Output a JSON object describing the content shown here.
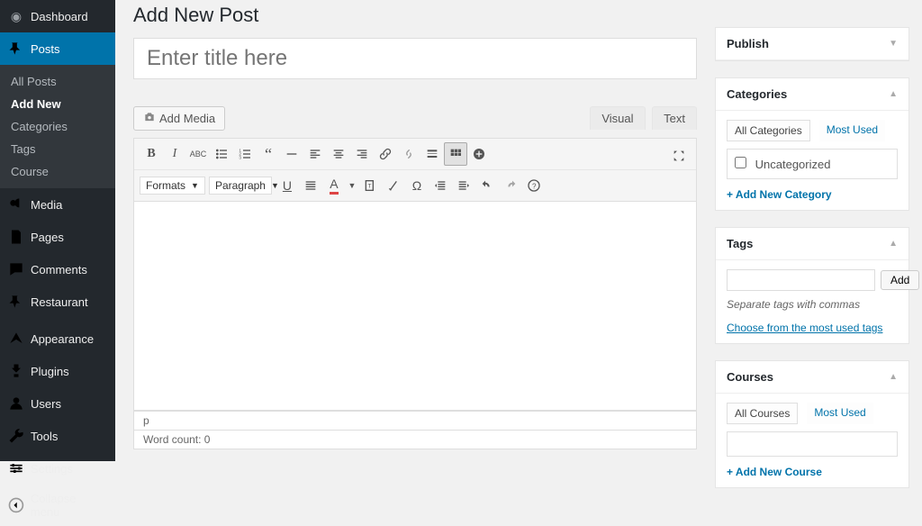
{
  "sidebar": {
    "dashboard": "Dashboard",
    "posts": "Posts",
    "posts_sub": {
      "all": "All Posts",
      "add": "Add New",
      "categories": "Categories",
      "tags": "Tags",
      "course": "Course"
    },
    "media": "Media",
    "pages": "Pages",
    "comments": "Comments",
    "restaurant": "Restaurant",
    "appearance": "Appearance",
    "plugins": "Plugins",
    "users": "Users",
    "tools": "Tools",
    "settings": "Settings",
    "collapse": "Collapse menu"
  },
  "page": {
    "title": "Add New Post",
    "title_placeholder": "Enter title here",
    "add_media": "Add Media",
    "tab_visual": "Visual",
    "tab_text": "Text",
    "formats_label": "Formats",
    "paragraph_label": "Paragraph",
    "path": "p",
    "wordcount": "Word count: 0"
  },
  "meta": {
    "publish": "Publish",
    "categories": {
      "title": "Categories",
      "tab_all": "All Categories",
      "tab_most": "Most Used",
      "uncategorized": "Uncategorized",
      "add": "+ Add New Category"
    },
    "tags": {
      "title": "Tags",
      "add_btn": "Add",
      "hint": "Separate tags with commas",
      "choose": "Choose from the most used tags"
    },
    "courses": {
      "title": "Courses",
      "tab_all": "All Courses",
      "tab_most": "Most Used",
      "add": "+ Add New Course"
    }
  }
}
